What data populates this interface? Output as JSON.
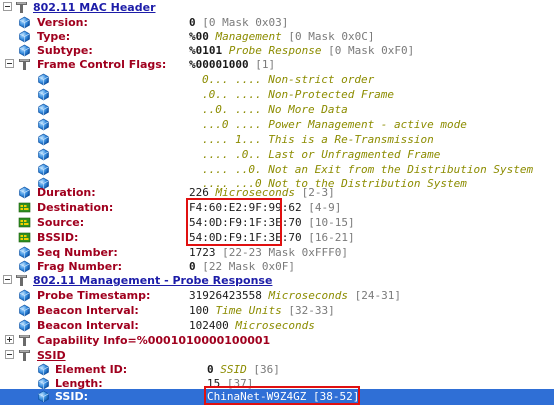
{
  "mac_header": {
    "title": "802.11 MAC Header",
    "version": {
      "label": "Version:",
      "value": "0",
      "detail": "[0 Mask 0x03]"
    },
    "type": {
      "label": "Type:",
      "value": "%00",
      "note": "Management",
      "detail": "[0 Mask 0x0C]"
    },
    "subtype": {
      "label": "Subtype:",
      "value": "%0101",
      "note": "Probe Response",
      "detail": "[0 Mask 0xF0]"
    },
    "fcf": {
      "label": "Frame Control Flags:",
      "value": "%00001000",
      "detail": "[1]",
      "flags": [
        "0... .... Non-strict order",
        ".0.. .... Non-Protected Frame",
        "..0. .... No More Data",
        "...0 .... Power Management - active mode",
        ".... 1... This is a Re-Transmission",
        ".... .0.. Last or Unfragmented Frame",
        ".... ..0. Not an Exit from the Distribution System",
        ".... ...0 Not to the Distribution System"
      ]
    },
    "duration": {
      "label": "Duration:",
      "value": "226",
      "note": "Microseconds",
      "detail": "[2-3]"
    },
    "destination": {
      "label": "Destination:",
      "value": "F4:60:E2:9F:99:62",
      "detail": "[4-9]"
    },
    "source": {
      "label": "Source:",
      "value": "54:0D:F9:1F:3E:70",
      "detail": "[10-15]"
    },
    "bssid": {
      "label": "BSSID:",
      "value": "54:0D:F9:1F:3E:70",
      "detail": "[16-21]"
    },
    "seq": {
      "label": "Seq Number:",
      "value": "1723",
      "detail": "[22-23 Mask 0xFFF0]"
    },
    "frag": {
      "label": "Frag Number:",
      "value": "0",
      "detail": "[22 Mask 0x0F]"
    }
  },
  "mgmt": {
    "title": "802.11 Management - Probe Response",
    "timestamp": {
      "label": "Probe Timestamp:",
      "value": "31926423558",
      "note": "Microseconds",
      "detail": "[24-31]"
    },
    "beacon1": {
      "label": "Beacon Interval:",
      "value": "100",
      "note": "Time Units",
      "detail": "[32-33]"
    },
    "beacon2": {
      "label": "Beacon Interval:",
      "value": "102400",
      "note": "Microseconds"
    },
    "capability": {
      "text": "Capability Info=%0001010000100001"
    },
    "ssid_group": {
      "title": "SSID",
      "element_id": {
        "label": "Element ID:",
        "value": "0",
        "note": "SSID",
        "detail": "[36]"
      },
      "length": {
        "label": "Length:",
        "value": "15",
        "detail": "[37]"
      },
      "ssid": {
        "label": "SSID:",
        "value": "ChinaNet-W9Z4GZ",
        "detail": "[38-52]"
      }
    }
  },
  "colors": {
    "field_label": "#a0001e",
    "header_link": "#1c1ca8",
    "annotation": "#8c8c00",
    "highlight_box": "#e01010",
    "selection": "#2f6fd6"
  },
  "icons": {
    "header": "protocol-header-icon",
    "field": "field-icon",
    "address": "address-icon",
    "expander": "tree-expander-icon"
  }
}
